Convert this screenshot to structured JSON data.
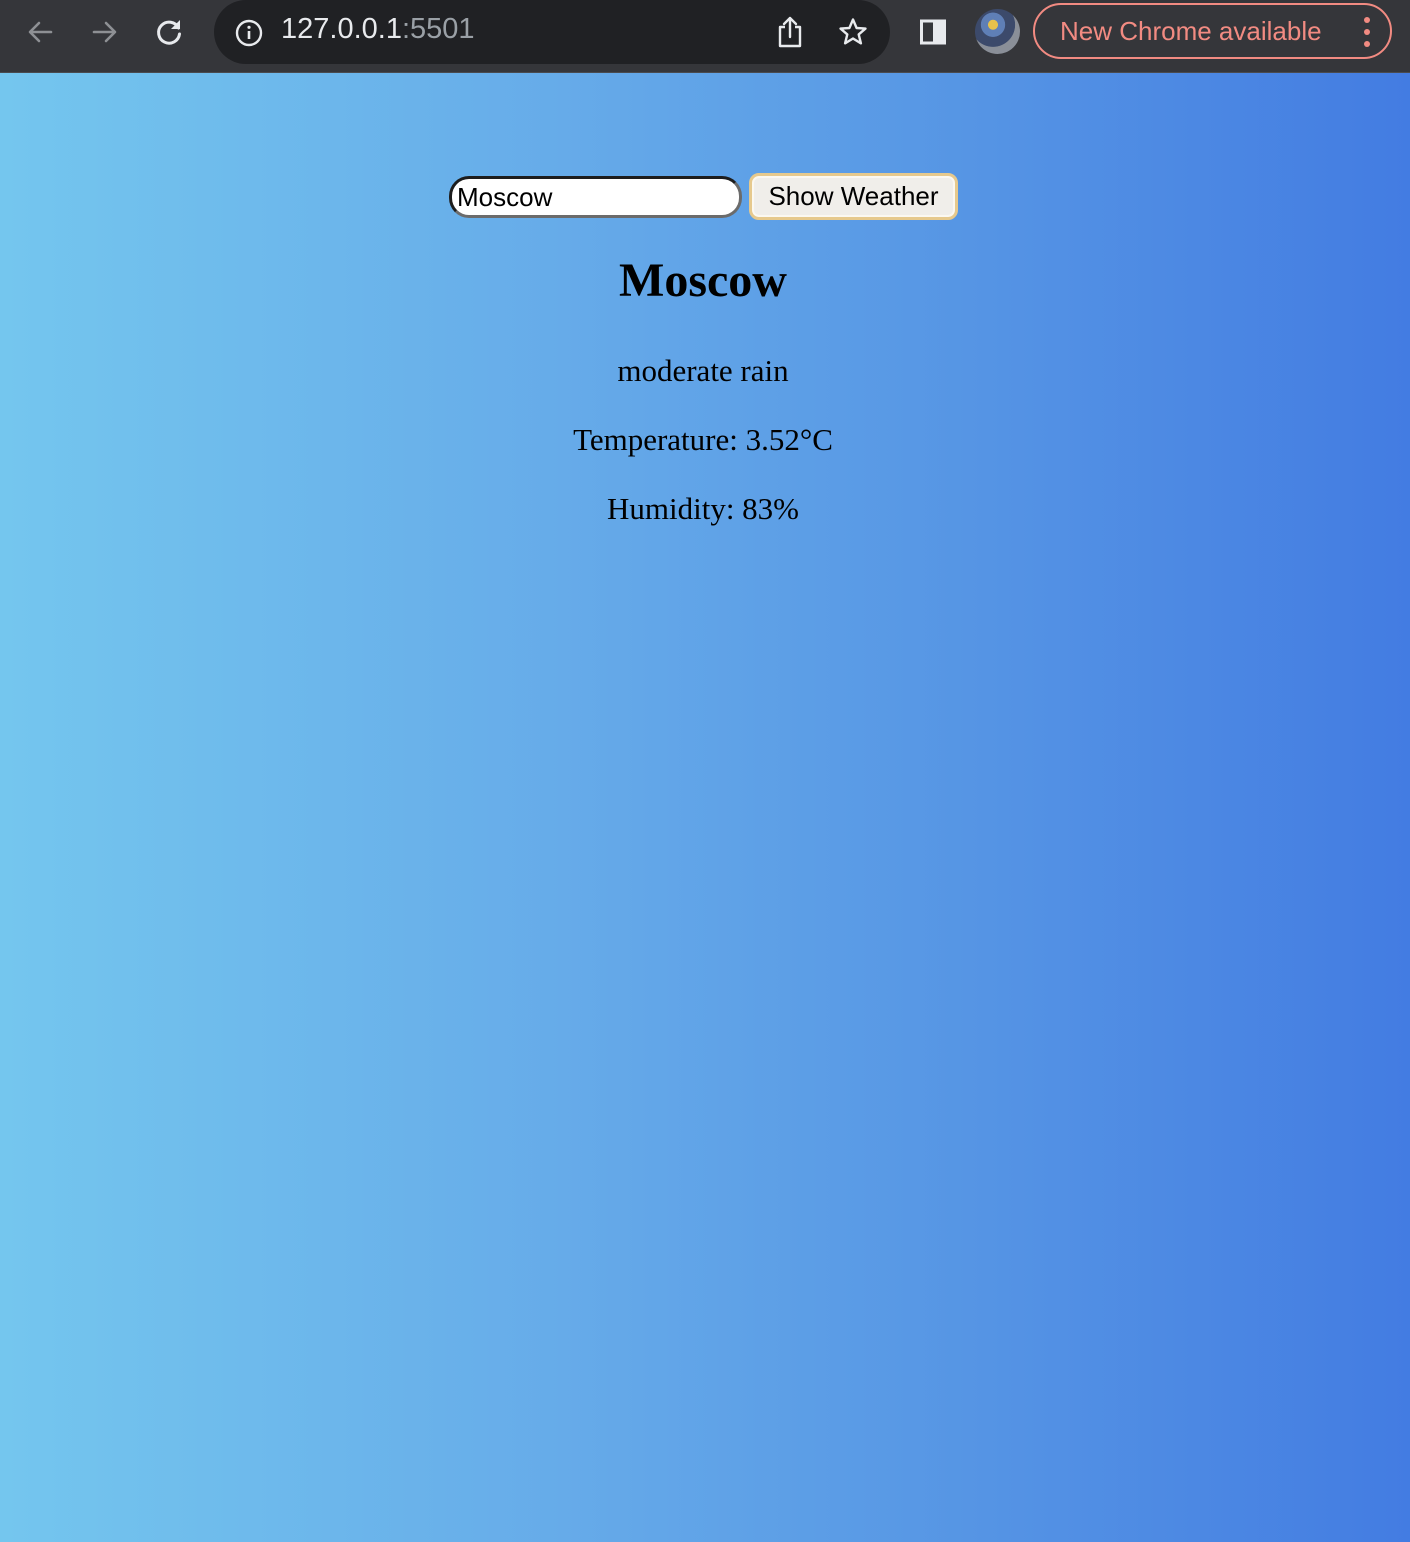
{
  "browser": {
    "url_host": "127.0.0.1",
    "url_port": ":5501",
    "update_label": "New Chrome available"
  },
  "search": {
    "value": "Moscow"
  },
  "button": {
    "label": "Show Weather"
  },
  "weather": {
    "city": "Moscow",
    "description": "moderate rain",
    "temperature": "Temperature: 3.52°C",
    "humidity": "Humidity: 83%"
  },
  "colors": {
    "toolbar": "#35363a",
    "omnibox": "#202124",
    "update_accent": "#f28b82",
    "gradient_start": "#74c6ee",
    "gradient_end": "#437ce2"
  }
}
